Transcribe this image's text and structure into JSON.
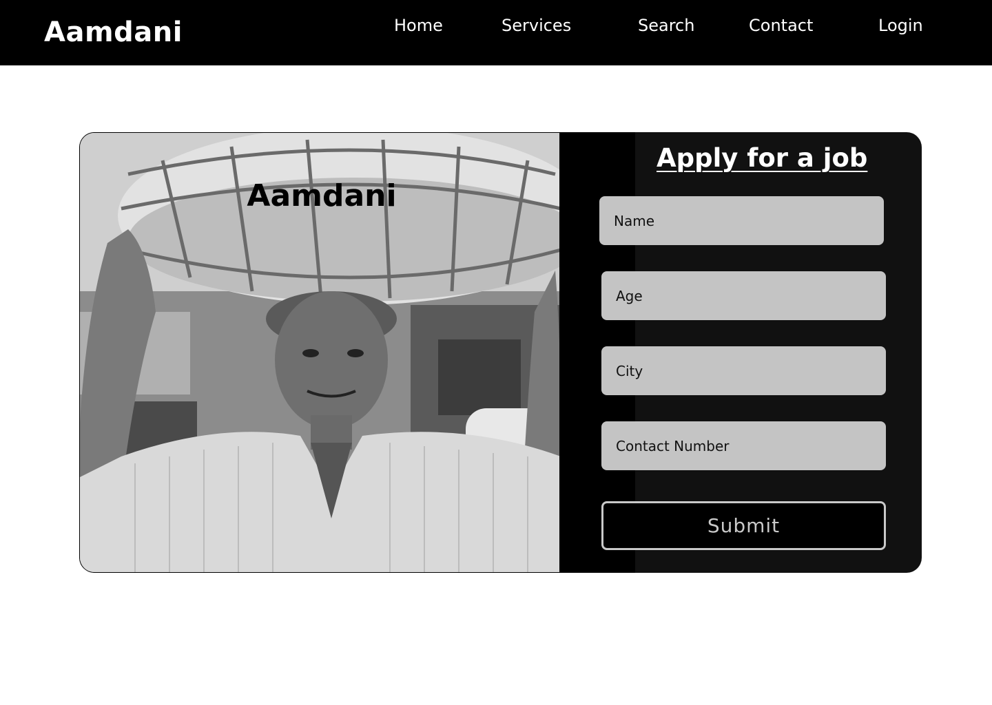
{
  "nav": {
    "brand": "Aamdani",
    "links": [
      {
        "label": "Home"
      },
      {
        "label": "Services"
      },
      {
        "label": "Search"
      },
      {
        "label": "Contact"
      },
      {
        "label": "Login"
      }
    ]
  },
  "hero": {
    "image_title": "Aamdani"
  },
  "form": {
    "title": "Apply for a job",
    "fields": [
      {
        "placeholder": "Name",
        "value": ""
      },
      {
        "placeholder": "Age",
        "value": ""
      },
      {
        "placeholder": "City",
        "value": ""
      },
      {
        "placeholder": "Contact Number",
        "value": ""
      }
    ],
    "submit_label": "Submit"
  },
  "colors": {
    "nav_background": "#000000",
    "form_panel": "#111111",
    "field_background": "#c4c4c4",
    "submit_border": "#c9c9c9"
  }
}
